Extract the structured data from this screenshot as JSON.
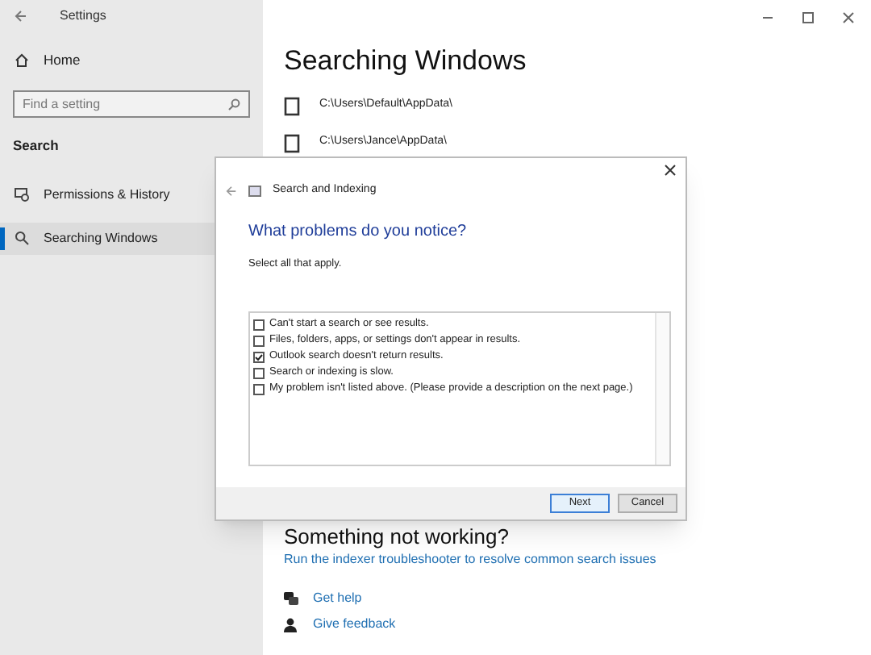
{
  "window": {
    "title": "Settings"
  },
  "sidebar": {
    "home": "Home",
    "search_placeholder": "Find a setting",
    "section": "Search",
    "items": [
      {
        "label": "Permissions & History",
        "selected": false
      },
      {
        "label": "Searching Windows",
        "selected": true
      }
    ]
  },
  "main": {
    "title": "Searching Windows",
    "folders": [
      "C:\\Users\\Default\\AppData\\",
      "C:\\Users\\Jance\\AppData\\"
    ],
    "trouble_heading": "Something not working?",
    "trouble_link": "Run the indexer troubleshooter to resolve common search issues",
    "help_links": [
      "Get help",
      "Give feedback"
    ]
  },
  "dialog": {
    "title": "Search and Indexing",
    "heading": "What problems do you notice?",
    "instruction": "Select all that apply.",
    "options": [
      {
        "label": "Can't start a search or see results.",
        "checked": false
      },
      {
        "label": "Files, folders, apps, or settings don't appear in results.",
        "checked": false
      },
      {
        "label": "Outlook search doesn't return results.",
        "checked": true
      },
      {
        "label": "Search or indexing is slow.",
        "checked": false
      },
      {
        "label": "My problem isn't listed above. (Please provide a description on the next page.)",
        "checked": false
      }
    ],
    "buttons": [
      {
        "label": "Next",
        "selected": true
      },
      {
        "label": "Cancel",
        "selected": false
      }
    ]
  }
}
